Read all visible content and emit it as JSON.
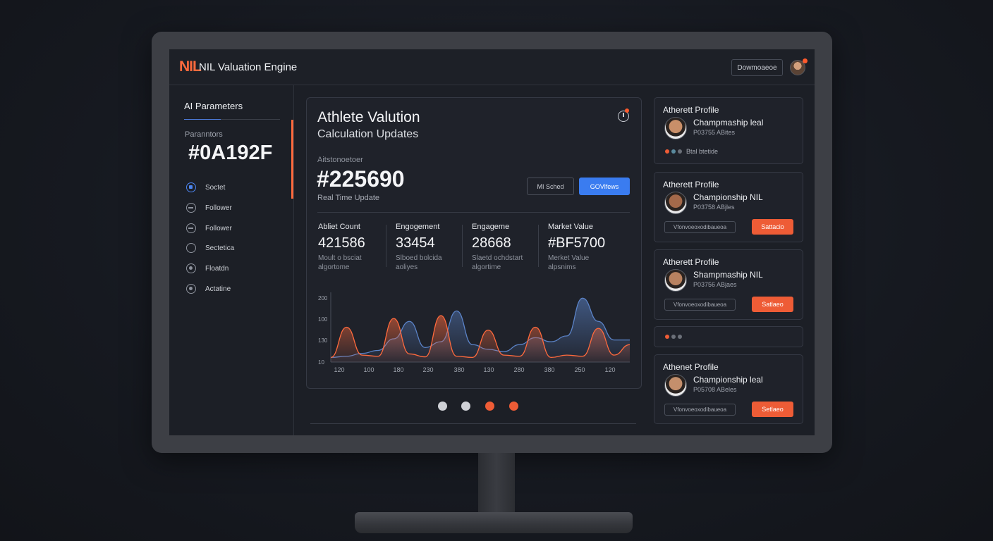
{
  "app": {
    "logo": "NIL",
    "title": "NIL Valuation Engine"
  },
  "header": {
    "button_label": "Dowmoaeoe"
  },
  "sidebar": {
    "title": "AI Parameters",
    "param_label": "Paranntors",
    "param_value": "#0A192F",
    "items": [
      {
        "label": "Soctet"
      },
      {
        "label": "Follower"
      },
      {
        "label": "Follower"
      },
      {
        "label": "Sectetica"
      },
      {
        "label": "Floatdn"
      },
      {
        "label": "Actatine"
      }
    ]
  },
  "main": {
    "title": "Athlete Valution",
    "subtitle": "Calculation Updates",
    "metric_label": "Aitstonoetoer",
    "metric_value": "#225690",
    "metric_caption": "Real Time Update",
    "button_outline": "MI Sched",
    "button_primary": "GOVlfews",
    "stats": [
      {
        "label": "Abliet Count",
        "value": "421586",
        "desc": "Moult o bsciat algortome"
      },
      {
        "label": "Engogement",
        "value": "33454",
        "desc": "Slboed bolcida aoliyes"
      },
      {
        "label": "Engageme",
        "value": "28668",
        "desc": "Slaetd ochdstart algortime"
      },
      {
        "label": "Market Value",
        "value": "#BF5700",
        "desc": "Merket Value alpsnims"
      }
    ]
  },
  "chart_data": {
    "type": "area",
    "y_ticks": [
      "200",
      "100",
      "130",
      "10"
    ],
    "x_ticks": [
      "120",
      "100",
      "180",
      "230",
      "380",
      "130",
      "280",
      "380",
      "250",
      "120"
    ],
    "series": [
      {
        "color": "#ff6a3d",
        "values": [
          8,
          60,
          12,
          10,
          75,
          14,
          9,
          80,
          10,
          8,
          55,
          12,
          10,
          60,
          8,
          12,
          10,
          58,
          12,
          30
        ]
      },
      {
        "color": "#5b83c7",
        "values": [
          8,
          10,
          15,
          20,
          40,
          70,
          25,
          35,
          88,
          30,
          22,
          18,
          30,
          42,
          35,
          45,
          110,
          70,
          38,
          38
        ]
      }
    ]
  },
  "pagination": {
    "dots": [
      "#cfd1d6",
      "#cfd1d6",
      "#ee5c36",
      "#ee5c36"
    ]
  },
  "profiles": [
    {
      "heading": "Atherett Profile",
      "name": "Champmaship leal",
      "sub": "P03755 ABites",
      "status": "Btal btetide",
      "status_dots": [
        "#ee5c36",
        "#5a8a9e",
        "#6b7079"
      ],
      "type": "status",
      "skin": "#c98f69"
    },
    {
      "heading": "Atherett Profile",
      "name": "Championship NIL",
      "sub": "P03758 ABjles",
      "field": "Vfonvoeoxodibaueoa",
      "button": "Sattacio",
      "type": "action",
      "skin": "#a4694a"
    },
    {
      "heading": "Atherett Profile",
      "name": "Shampmaship NIL",
      "sub": "P03756 ABjaes",
      "field": "Vfonvoeoxodibaueoa",
      "button": "Satlaeo",
      "type": "action",
      "skin": "#b98260"
    },
    {
      "heading": "Athenet Profile",
      "name": "Championship leal",
      "sub": "P05708 ABeles",
      "field": "Vfonvoeoxodibaueoa",
      "button": "Setlaeo",
      "type": "action",
      "skin": "#c48f6c"
    }
  ],
  "separator_dots": [
    "#ee5c36",
    "#6b7079",
    "#6b7079"
  ]
}
